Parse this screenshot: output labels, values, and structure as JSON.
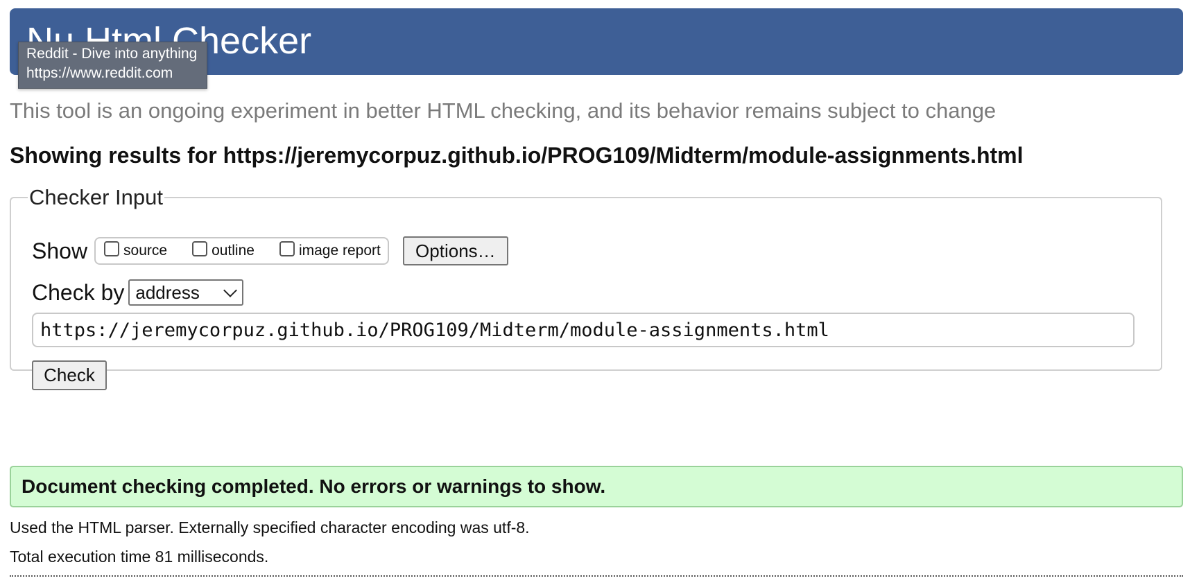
{
  "header": {
    "title": "Nu Html Checker"
  },
  "tooltip": {
    "title": "Reddit - Dive into anything",
    "url": "https://www.reddit.com"
  },
  "tagline": "This tool is an ongoing experiment in better HTML checking, and its behavior remains subject to change",
  "results_for": "Showing results for https://jeremycorpuz.github.io/PROG109/Midterm/module-assignments.html",
  "checker_input": {
    "legend": "Checker Input",
    "show_label": "Show",
    "show_options": [
      {
        "label": "source",
        "checked": false
      },
      {
        "label": "outline",
        "checked": false
      },
      {
        "label": "image report",
        "checked": false
      }
    ],
    "options_button": "Options…",
    "check_by_label": "Check by",
    "check_by_selected": "address",
    "url_value": "https://jeremycorpuz.github.io/PROG109/Midterm/module-assignments.html",
    "check_button": "Check"
  },
  "result": {
    "message": "Document checking completed. No errors or warnings to show.",
    "parser_info": "Used the HTML parser. Externally specified character encoding was utf-8.",
    "execution_time": "Total execution time 81 milliseconds."
  },
  "colors": {
    "header_bg": "#3e5f96",
    "success_bg": "#d4fcd4",
    "tagline": "#7a7a7a"
  }
}
